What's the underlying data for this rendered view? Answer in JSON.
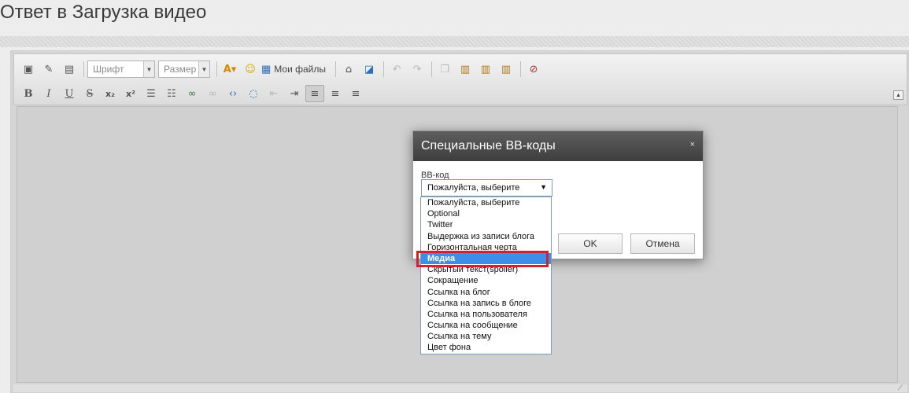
{
  "page": {
    "title": "Ответ в Загрузка видео"
  },
  "toolbar": {
    "font_combo": "Шрифт",
    "size_combo": "Размер",
    "my_files": "Мои файлы",
    "font_color_label": "A"
  },
  "dialog": {
    "title": "Специальные BB-коды",
    "close": "×",
    "field_label": "BB-код",
    "select_value": "Пожалуйста, выберите",
    "ok": "OK",
    "cancel": "Отмена"
  },
  "dropdown": {
    "options": [
      "Пожалуйста, выберите",
      "Optional",
      "Twitter",
      "Выдержка из записи блога",
      "Горизонтальная черта",
      "Медиа",
      "Скрытый текст(spoiler)",
      "Сокращение",
      "Ссылка на блог",
      "Ссылка на запись в блоге",
      "Ссылка на пользователя",
      "Ссылка на сообщение",
      "Ссылка на тему",
      "Цвет фона"
    ],
    "selected_index": 5
  },
  "colors": {
    "highlight_border": "#d4202d",
    "selected_option": "#3d8ee8",
    "dialog_header": "#4a4a4a"
  }
}
